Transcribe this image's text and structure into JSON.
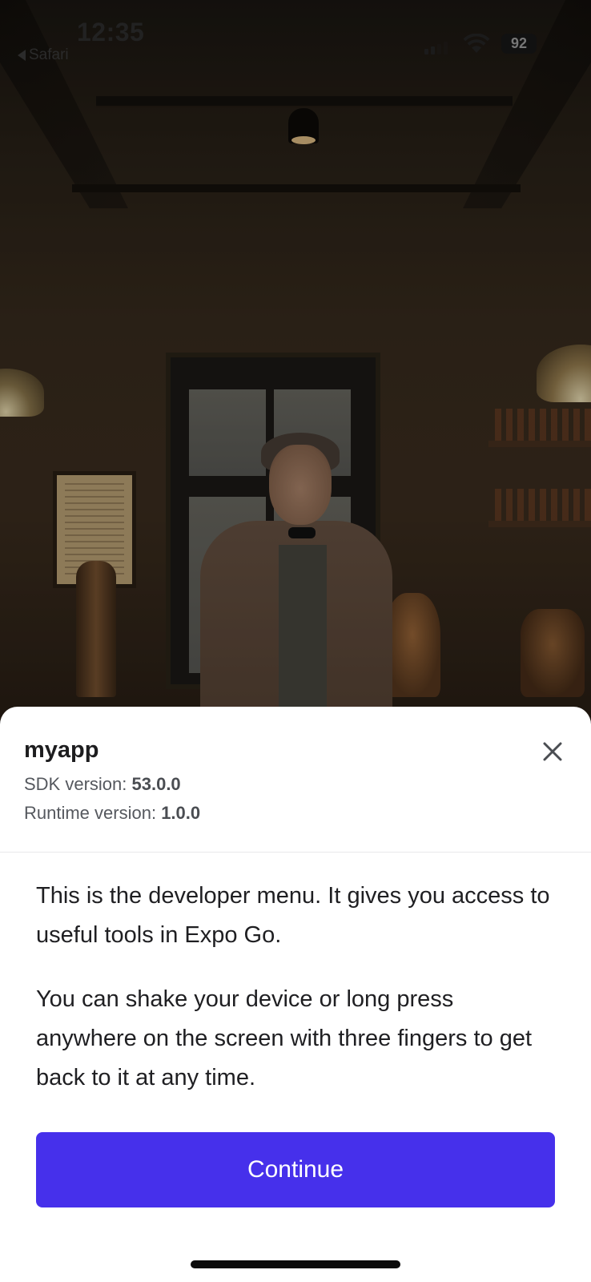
{
  "status_bar": {
    "time": "12:35",
    "back_app_label": "Safari",
    "battery_level": "92"
  },
  "sheet": {
    "app_name": "myapp",
    "sdk_label": "SDK version: ",
    "sdk_value": "53.0.0",
    "runtime_label": "Runtime version: ",
    "runtime_value": "1.0.0",
    "close_icon": "close-icon",
    "intro_paragraph_1": "This is the developer menu. It gives you access to useful tools in Expo Go.",
    "intro_paragraph_2": "You can shake your device or long press anywhere on the screen with three fingers to get back to it at any time.",
    "continue_label": "Continue"
  },
  "colors": {
    "accent": "#4630eb",
    "text_primary": "#1d1d1f",
    "text_secondary": "#55585e"
  }
}
